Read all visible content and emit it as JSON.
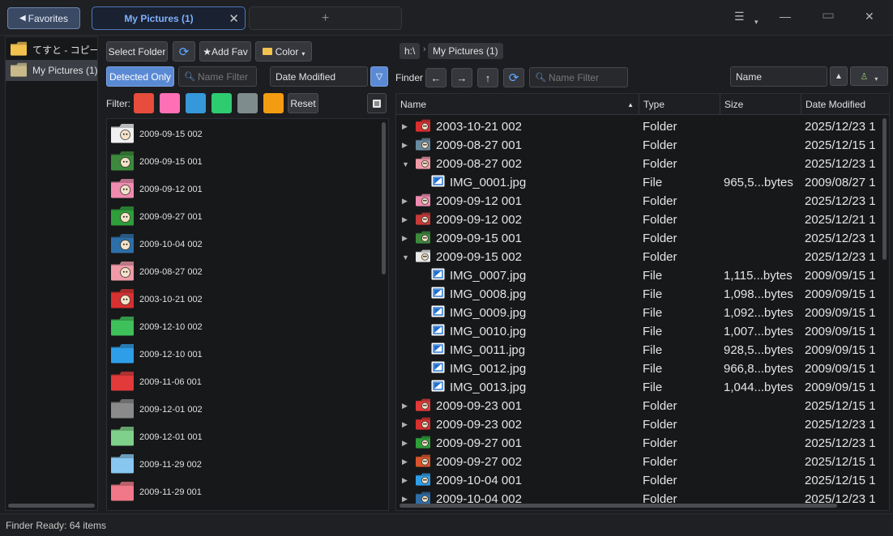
{
  "titlebar": {
    "favorites_label": "Favorites",
    "active_tab": "My Pictures (1)",
    "new_tab": "+",
    "controls": {
      "menu": "☰",
      "menu_arrow": "▾",
      "minimize": "—",
      "maximize": "▭",
      "close": "✕"
    }
  },
  "favorites": {
    "items": [
      {
        "label": "てすと - コピー",
        "selected": false
      },
      {
        "label": "My Pictures (1)",
        "selected": true
      }
    ]
  },
  "toolbar": {
    "select_folder": "Select Folder",
    "add_fav": "Add Fav",
    "color": "Color",
    "detected_only": "Detected Only",
    "name_filter_placeholder": "Name Filter",
    "sort_field": "Date Modified"
  },
  "color_filter": {
    "label": "Filter:",
    "swatches": [
      "#e74c3c",
      "#ff6fb5",
      "#3498db",
      "#2ecc71",
      "#7f8c8d",
      "#f39c12"
    ],
    "reset": "Reset"
  },
  "folders": [
    {
      "name": "2009-09-15 002",
      "color": "#f0f0f0",
      "face": "dog"
    },
    {
      "name": "2009-09-15 001",
      "color": "#3c8a3c",
      "face": "raccoon"
    },
    {
      "name": "2009-09-12 001",
      "color": "#f08bb0",
      "face": "cat"
    },
    {
      "name": "2009-09-27 001",
      "color": "#2e9e3a",
      "face": "fox"
    },
    {
      "name": "2009-10-04 002",
      "color": "#2d6fa8",
      "face": "dog"
    },
    {
      "name": "2009-08-27 002",
      "color": "#f09aa8",
      "face": "dog"
    },
    {
      "name": "2003-10-21 002",
      "color": "#d83030",
      "face": "dog"
    },
    {
      "name": "2009-12-10 002",
      "color": "#3ec05a",
      "face": ""
    },
    {
      "name": "2009-12-10 001",
      "color": "#2f9ee8",
      "face": ""
    },
    {
      "name": "2009-11-06 001",
      "color": "#e23a3a",
      "face": ""
    },
    {
      "name": "2009-12-01 002",
      "color": "#8a8a8a",
      "face": ""
    },
    {
      "name": "2009-12-01 001",
      "color": "#7fd08a",
      "face": ""
    },
    {
      "name": "2009-11-29 002",
      "color": "#88c8f0",
      "face": ""
    },
    {
      "name": "2009-11-29 001",
      "color": "#f07888",
      "face": ""
    }
  ],
  "finder": {
    "path_root": "h:\\",
    "path_folder": "My Pictures (1)",
    "label": "Finder",
    "name_filter_placeholder": "Name Filter",
    "sort_field": "Name",
    "columns": [
      "Name",
      "Type",
      "Size",
      "Date Modified"
    ],
    "rows": [
      {
        "name": "2003-10-21 002",
        "type": "Folder",
        "size": "",
        "date": "2025/12/23 1",
        "kind": "folder",
        "expanded": false,
        "color": "#d83030"
      },
      {
        "name": "2009-08-27 001",
        "type": "Folder",
        "size": "",
        "date": "2025/12/15 1",
        "kind": "folder",
        "expanded": false,
        "color": "#6a8aa0"
      },
      {
        "name": "2009-08-27 002",
        "type": "Folder",
        "size": "",
        "date": "2025/12/23 1",
        "kind": "folder",
        "expanded": true,
        "color": "#f09aa8"
      },
      {
        "name": "IMG_0001.jpg",
        "type": "File",
        "size": "965,5...bytes",
        "date": "2009/08/27 1",
        "kind": "file"
      },
      {
        "name": "2009-09-12 001",
        "type": "Folder",
        "size": "",
        "date": "2025/12/23 1",
        "kind": "folder",
        "expanded": false,
        "color": "#f08bb0"
      },
      {
        "name": "2009-09-12 002",
        "type": "Folder",
        "size": "",
        "date": "2025/12/21 1",
        "kind": "folder",
        "expanded": false,
        "color": "#c83a3a"
      },
      {
        "name": "2009-09-15 001",
        "type": "Folder",
        "size": "",
        "date": "2025/12/23 1",
        "kind": "folder",
        "expanded": false,
        "color": "#3c8a3c"
      },
      {
        "name": "2009-09-15 002",
        "type": "Folder",
        "size": "",
        "date": "2025/12/23 1",
        "kind": "folder",
        "expanded": true,
        "color": "#e8e8e8"
      },
      {
        "name": "IMG_0007.jpg",
        "type": "File",
        "size": "1,115...bytes",
        "date": "2009/09/15 1",
        "kind": "file"
      },
      {
        "name": "IMG_0008.jpg",
        "type": "File",
        "size": "1,098...bytes",
        "date": "2009/09/15 1",
        "kind": "file"
      },
      {
        "name": "IMG_0009.jpg",
        "type": "File",
        "size": "1,092...bytes",
        "date": "2009/09/15 1",
        "kind": "file"
      },
      {
        "name": "IMG_0010.jpg",
        "type": "File",
        "size": "1,007...bytes",
        "date": "2009/09/15 1",
        "kind": "file"
      },
      {
        "name": "IMG_0011.jpg",
        "type": "File",
        "size": "928,5...bytes",
        "date": "2009/09/15 1",
        "kind": "file"
      },
      {
        "name": "IMG_0012.jpg",
        "type": "File",
        "size": "966,8...bytes",
        "date": "2009/09/15 1",
        "kind": "file"
      },
      {
        "name": "IMG_0013.jpg",
        "type": "File",
        "size": "1,044...bytes",
        "date": "2009/09/15 1",
        "kind": "file"
      },
      {
        "name": "2009-09-23 001",
        "type": "Folder",
        "size": "",
        "date": "2025/12/15 1",
        "kind": "folder",
        "expanded": false,
        "color": "#e23a3a"
      },
      {
        "name": "2009-09-23 002",
        "type": "Folder",
        "size": "",
        "date": "2025/12/23 1",
        "kind": "folder",
        "expanded": false,
        "color": "#d83030"
      },
      {
        "name": "2009-09-27 001",
        "type": "Folder",
        "size": "",
        "date": "2025/12/23 1",
        "kind": "folder",
        "expanded": false,
        "color": "#2e9e3a"
      },
      {
        "name": "2009-09-27 002",
        "type": "Folder",
        "size": "",
        "date": "2025/12/15 1",
        "kind": "folder",
        "expanded": false,
        "color": "#d8542a"
      },
      {
        "name": "2009-10-04 001",
        "type": "Folder",
        "size": "",
        "date": "2025/12/15 1",
        "kind": "folder",
        "expanded": false,
        "color": "#2f9ee8"
      },
      {
        "name": "2009-10-04 002",
        "type": "Folder",
        "size": "",
        "date": "2025/12/23 1",
        "kind": "folder",
        "expanded": false,
        "color": "#2d6fa8"
      }
    ]
  },
  "status": {
    "text": "Finder Ready: 64 items"
  }
}
